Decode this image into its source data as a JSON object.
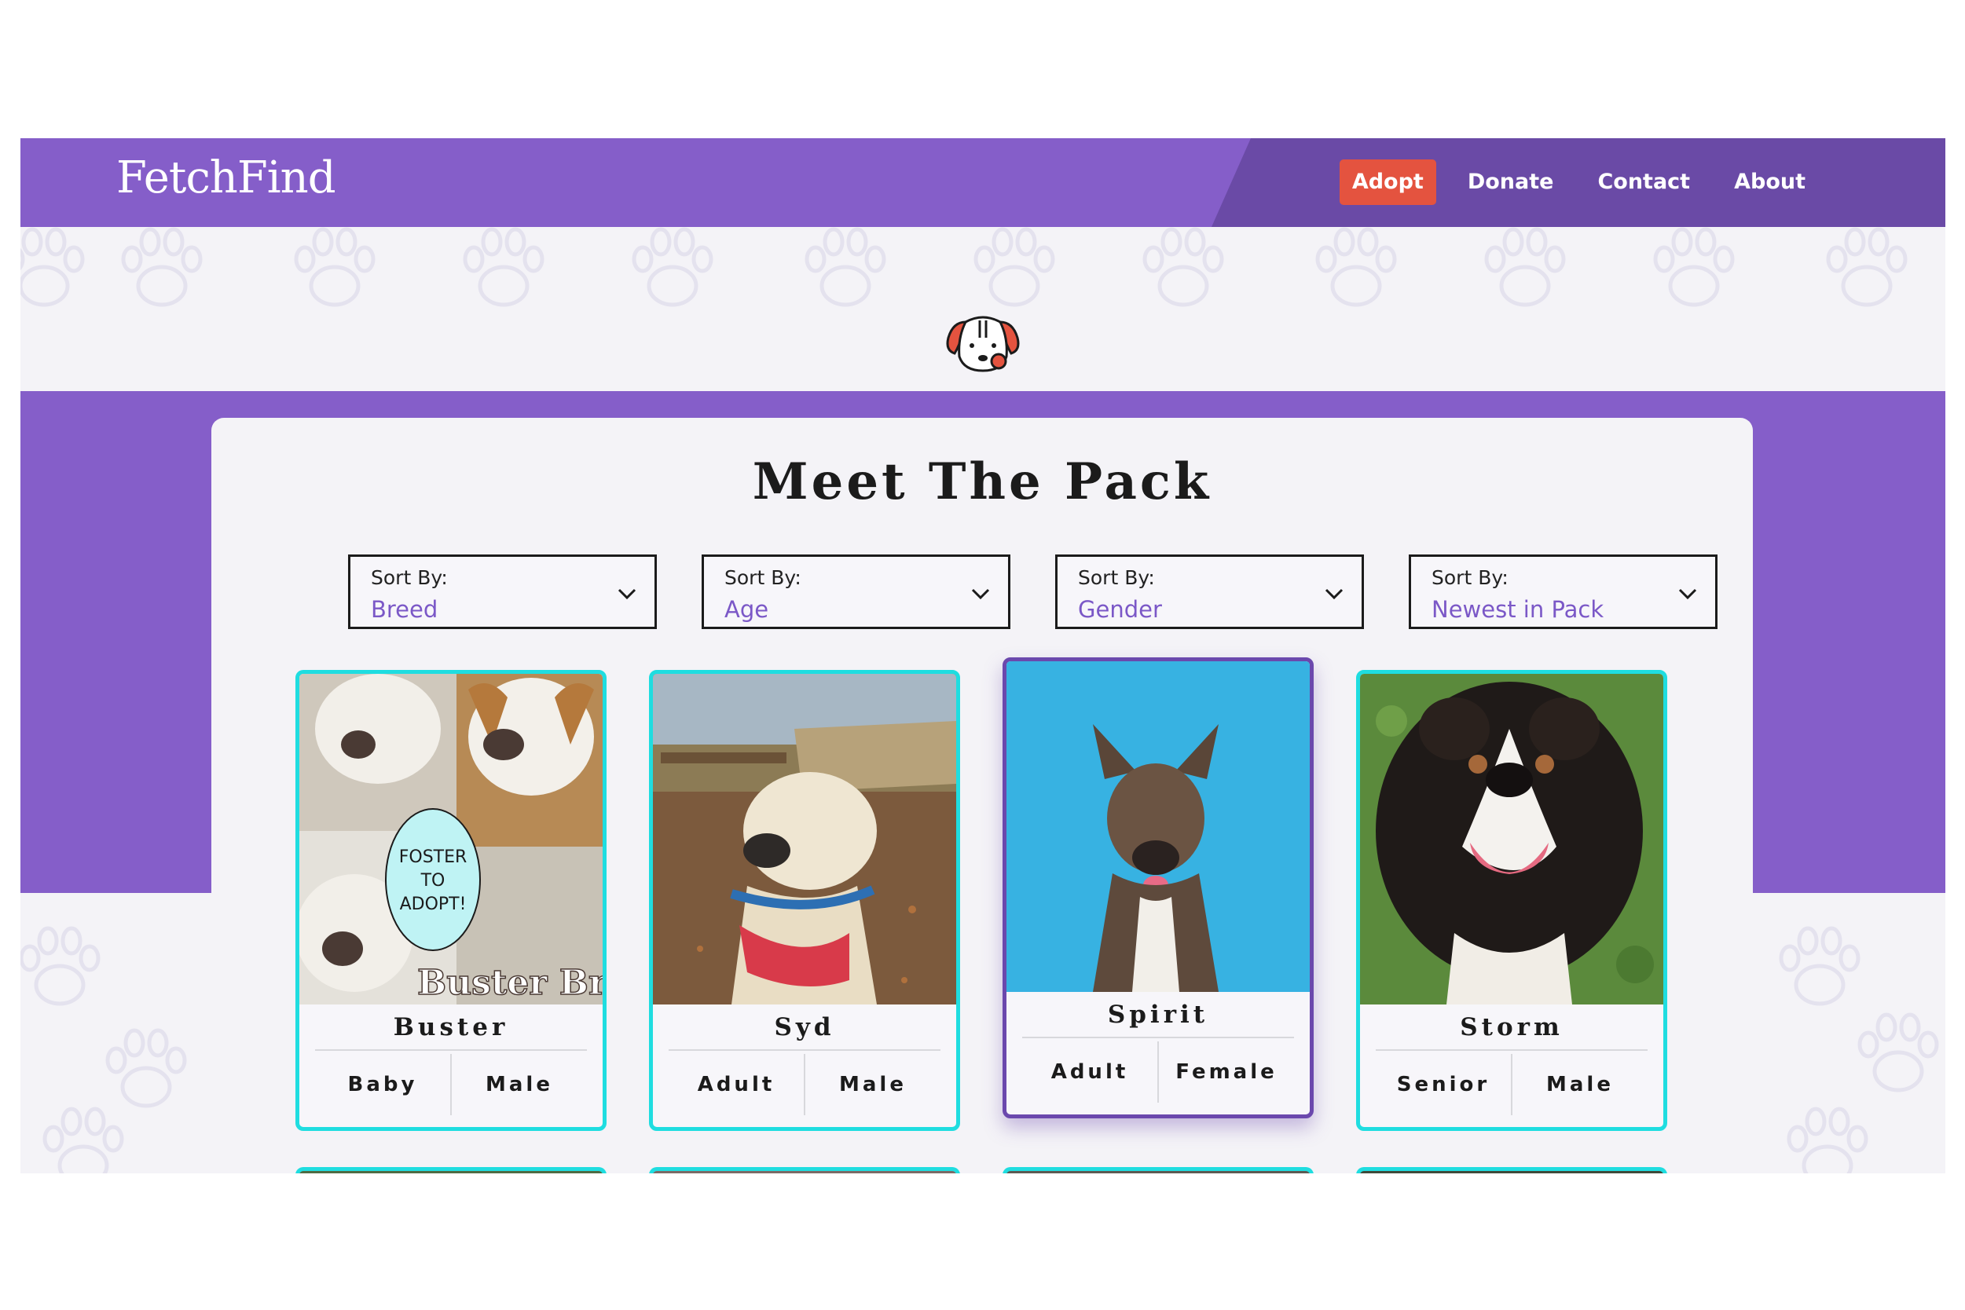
{
  "header": {
    "logo": "FetchFind",
    "nav": [
      {
        "label": "Adopt",
        "active": true
      },
      {
        "label": "Donate",
        "active": false
      },
      {
        "label": "Contact",
        "active": false
      },
      {
        "label": "About",
        "active": false
      }
    ]
  },
  "main": {
    "title": "Meet The Pack",
    "sorts": [
      {
        "label": "Sort By:",
        "value": "Breed"
      },
      {
        "label": "Sort By:",
        "value": "Age"
      },
      {
        "label": "Sort By:",
        "value": "Gender"
      },
      {
        "label": "Sort By:",
        "value": "Newest in Pack"
      }
    ],
    "pets": [
      {
        "name": "Buster",
        "age": "Baby",
        "gender": "Male",
        "photo_text": {
          "bubble": [
            "FOSTER",
            "TO",
            "ADOPT!"
          ],
          "caption": "Buster Brow"
        }
      },
      {
        "name": "Syd",
        "age": "Adult",
        "gender": "Male"
      },
      {
        "name": "Spirit",
        "age": "Adult",
        "gender": "Female"
      },
      {
        "name": "Storm",
        "age": "Senior",
        "gender": "Male"
      }
    ]
  },
  "colors": {
    "header": "#855ec9",
    "header_dark": "#6a4aa6",
    "accent": "#e4533f",
    "card_border": "#1fdde0",
    "card_selected": "#6b48ad",
    "sort_value": "#7b58c7"
  }
}
